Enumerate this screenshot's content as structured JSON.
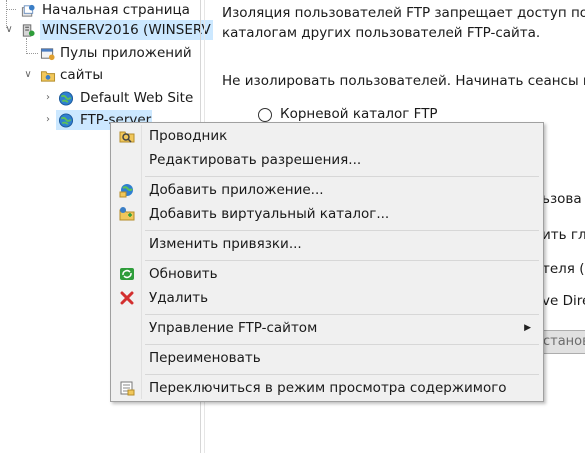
{
  "tree": {
    "items": [
      {
        "label": "Начальная страница",
        "icon": "home-page-icon"
      },
      {
        "label": "WINSERV2016 (WINSERV",
        "icon": "server-icon"
      },
      {
        "label": "Пулы приложений",
        "icon": "app-pools-icon"
      },
      {
        "label": "сайты",
        "icon": "sites-folder-icon"
      },
      {
        "label": "Default Web Site",
        "icon": "globe-icon"
      },
      {
        "label": "FTP-server",
        "icon": "globe-icon"
      }
    ]
  },
  "content": {
    "line1": "Изоляция пользователей FTP запрещает доступ польз",
    "line2": "каталогам других пользователей FTP-сайта.",
    "line3": "Не изолировать пользователей. Начинать сеансы п",
    "radio1": "Корневой каталог FTP",
    "frag1": "ьзова",
    "frag2": "ить гл",
    "frag3": "теля (в",
    "frag4": "ve Dire",
    "button_text": "станов"
  },
  "menu": {
    "items": [
      {
        "label": "Проводник",
        "icon": "explorer-icon"
      },
      {
        "label": "Редактировать разрешения...",
        "icon": ""
      },
      {
        "label": "Добавить приложение...",
        "icon": "add-application-icon"
      },
      {
        "label": "Добавить виртуальный каталог...",
        "icon": "add-virtual-directory-icon"
      },
      {
        "label": "Изменить привязки...",
        "icon": ""
      },
      {
        "label": "Обновить",
        "icon": "refresh-icon"
      },
      {
        "label": "Удалить",
        "icon": "delete-icon"
      },
      {
        "label": "Управление FTP-сайтом",
        "icon": "",
        "submenu": true
      },
      {
        "label": "Переименовать",
        "icon": ""
      },
      {
        "label": "Переключиться в режим просмотра содержимого",
        "icon": "content-view-icon"
      }
    ]
  },
  "colors": {
    "selection": "#cce8ff",
    "menu_bg": "#f0f0f0",
    "delete_red": "#d32f2f",
    "refresh_green": "#2e9d3a"
  }
}
